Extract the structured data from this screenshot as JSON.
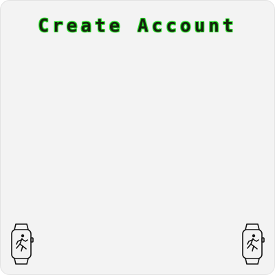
{
  "screen": {
    "title": "Create Account"
  },
  "icons": {
    "left": "smartwatch-running-icon",
    "right": "smartwatch-running-icon"
  },
  "colors": {
    "background": "#f3f3f3",
    "title_text": "#17210f",
    "title_glow": "#28e028",
    "icon_stroke": "#111111"
  }
}
